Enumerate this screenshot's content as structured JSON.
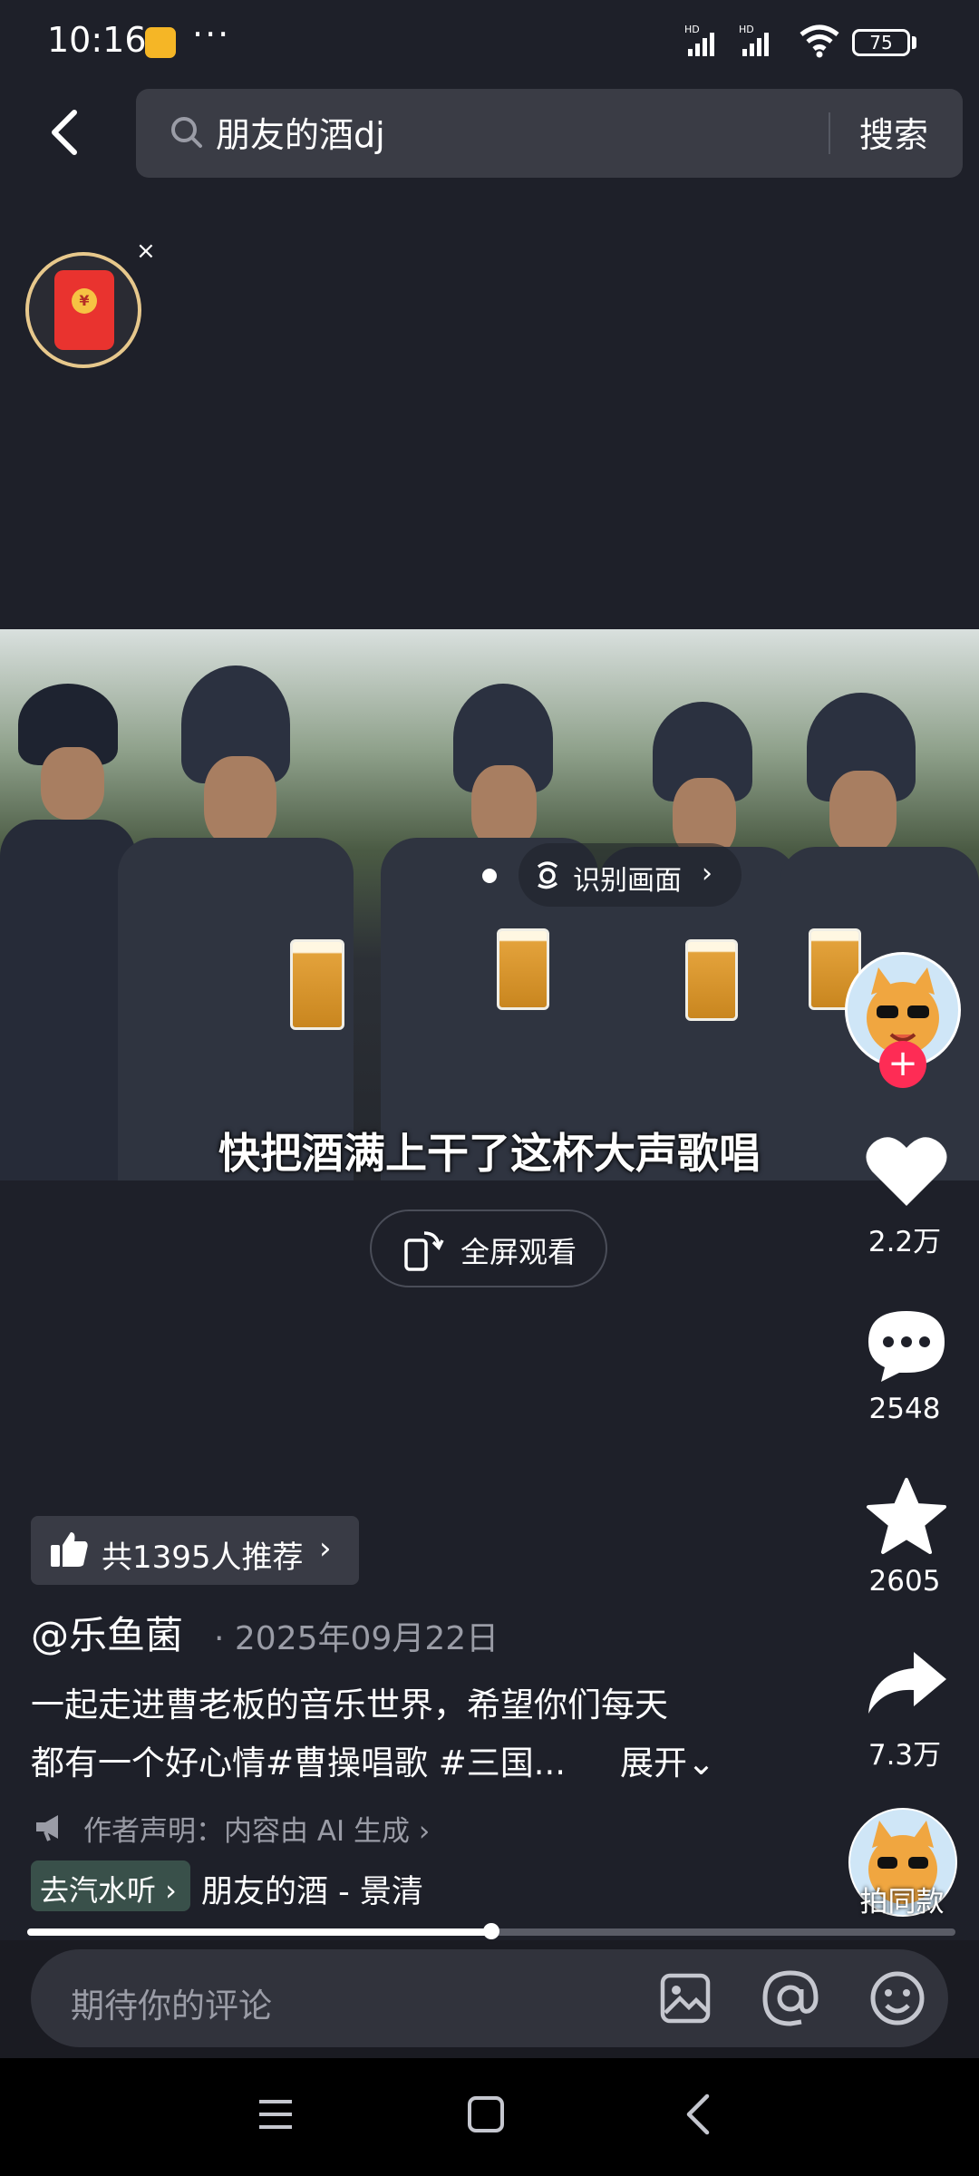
{
  "status_bar": {
    "time": "10:16",
    "more": "···",
    "battery": "75",
    "signal_label": "HD"
  },
  "search": {
    "query": "朋友的酒dj",
    "button_label": "搜索"
  },
  "red_packet": {
    "close": "×",
    "seal": "¥"
  },
  "video": {
    "identify_label": "识别画面",
    "identify_chevron": "›",
    "subtitle": "快把酒满上干了这杯大声歌唱",
    "fullscreen_label": "全屏观看",
    "progress": 0.5
  },
  "actions": {
    "follow": "+",
    "likes": "2.2万",
    "comments": "2548",
    "favorites": "2605",
    "shares": "7.3万",
    "make_same": "拍同款"
  },
  "post": {
    "recommend_label": "共1395人推荐",
    "recommend_chevron": "›",
    "author": "@乐鱼菌",
    "date": "· 2025年09月22日",
    "description_line1": "一起走进曹老板的音乐世界，希望你们每天",
    "description_line2": "都有一个好心情#曹操唱歌 #三国...",
    "expand_label": "展开⌄",
    "ai_notice": "作者声明：内容由 AI 生成 ›",
    "music_tag": "去汽水听 ›",
    "music_name": "朋友的酒 - 景清"
  },
  "comment_bar": {
    "placeholder": "期待你的评论"
  },
  "colors": {
    "background": "#1e2029",
    "accent_red": "#fe2c55",
    "music_tag": "#39504a"
  }
}
